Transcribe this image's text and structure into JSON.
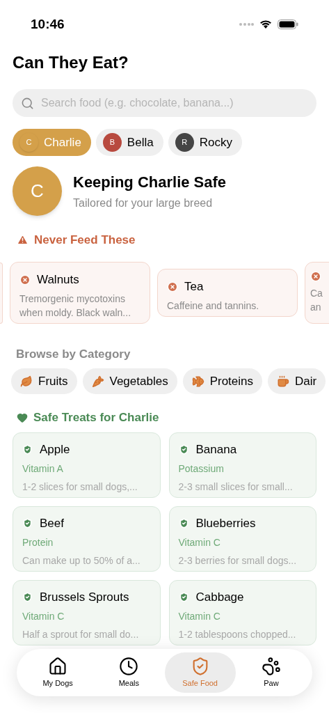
{
  "status_bar": {
    "time": "10:46"
  },
  "title": "Can They Eat?",
  "search": {
    "placeholder": "Search food (e.g. chocolate, banana...)"
  },
  "dogs": [
    {
      "initial": "C",
      "name": "Charlie",
      "color": "#d4a04a",
      "selected": true
    },
    {
      "initial": "B",
      "name": "Bella",
      "color": "#b84a3f",
      "selected": false
    },
    {
      "initial": "R",
      "name": "Rocky",
      "color": "#454545",
      "selected": false
    }
  ],
  "profile": {
    "initial": "C",
    "title": "Keeping Charlie Safe",
    "subtitle": "Tailored for your large breed"
  },
  "never_feed": {
    "heading": "Never Feed These",
    "items": [
      {
        "kind": "full",
        "name": "Walnuts",
        "description": "Tremorgenic mycotoxins when moldy. Black waln..."
      },
      {
        "kind": "full",
        "name": "Tea",
        "description": "Caffeine and tannins."
      },
      {
        "kind": "partial",
        "description": "Ca an"
      }
    ]
  },
  "categories": {
    "heading": "Browse by Category",
    "items": [
      {
        "kind": "fruits",
        "label": "Fruits"
      },
      {
        "kind": "vegetables",
        "label": "Vegetables"
      },
      {
        "kind": "proteins",
        "label": "Proteins"
      },
      {
        "kind": "dairy",
        "label": "Dair"
      }
    ]
  },
  "safe_treats": {
    "heading": "Safe Treats for Charlie",
    "items": [
      {
        "name": "Apple",
        "nutrient": "Vitamin A",
        "note": "1-2 slices for small dogs,..."
      },
      {
        "name": "Banana",
        "nutrient": "Potassium",
        "note": "2-3 small slices for small..."
      },
      {
        "name": "Beef",
        "nutrient": "Protein",
        "note": "Can make up to 50% of a..."
      },
      {
        "name": "Blueberries",
        "nutrient": "Vitamin C",
        "note": "2-3 berries for small dogs..."
      },
      {
        "name": "Brussels Sprouts",
        "nutrient": "Vitamin C",
        "note": "Half a sprout for small do..."
      },
      {
        "name": "Cabbage",
        "nutrient": "Vitamin C",
        "note": "1-2 tablespoons chopped..."
      }
    ]
  },
  "tab_bar": [
    {
      "kind": "home",
      "label": "My Dogs",
      "selected": false
    },
    {
      "kind": "clock",
      "label": "Meals",
      "selected": false
    },
    {
      "kind": "shield",
      "label": "Safe Food",
      "selected": true
    },
    {
      "kind": "paw",
      "label": "Paw",
      "selected": false
    }
  ]
}
